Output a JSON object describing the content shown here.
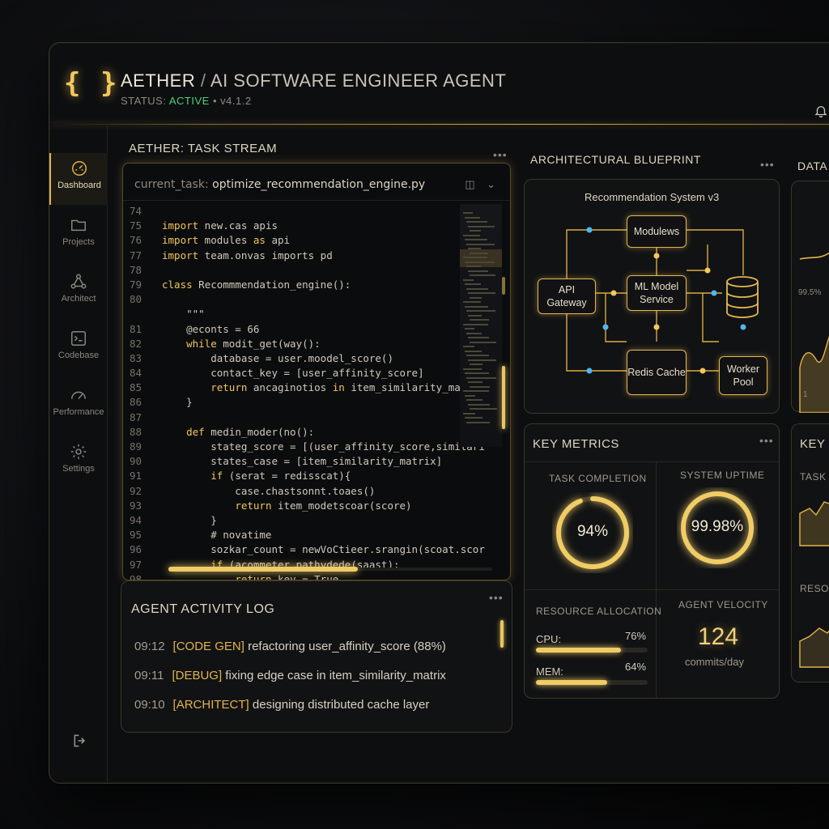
{
  "header": {
    "logo": "{ }",
    "app_name": "AETHER",
    "separator": "/",
    "subtitle": "AI SOFTWARE ENGINEER AGENT",
    "status_label": "STATUS:",
    "status_value": "ACTIVE",
    "version": "• v4.1.2"
  },
  "sidebar": {
    "items": [
      {
        "label": "Dashboard",
        "icon": "gauge-icon"
      },
      {
        "label": "Projects",
        "icon": "folder-icon"
      },
      {
        "label": "Architect",
        "icon": "nodes-icon"
      },
      {
        "label": "Codebase",
        "icon": "terminal-icon"
      },
      {
        "label": "Performance",
        "icon": "speedometer-icon"
      },
      {
        "label": "Settings",
        "icon": "gear-icon"
      }
    ]
  },
  "task_stream": {
    "title": "AETHER: TASK STREAM",
    "tab_prefix": "current_task:",
    "tab_file": "optimize_recommendation_engine.py",
    "lines": [
      {
        "n": "74",
        "code": ""
      },
      {
        "n": "75",
        "code": "import new.cas apis"
      },
      {
        "n": "76",
        "code": "import modules as api"
      },
      {
        "n": "77",
        "code": "import team.onvas imports pd"
      },
      {
        "n": "78",
        "code": ""
      },
      {
        "n": "79",
        "code": "class Recommmendation_engine():"
      },
      {
        "n": "80",
        "code": ""
      },
      {
        "n": "",
        "code": "    \"\"\""
      },
      {
        "n": "81",
        "code": "    @econts = 66"
      },
      {
        "n": "82",
        "code": "    while modit_get(way():"
      },
      {
        "n": "83",
        "code": "        database = user.moodel_score()"
      },
      {
        "n": "84",
        "code": "        contact_key = [user_affinity_score]"
      },
      {
        "n": "85",
        "code": "        return ancaginotios in item_similarity_matrix"
      },
      {
        "n": "86",
        "code": "    }"
      },
      {
        "n": "87",
        "code": ""
      },
      {
        "n": "88",
        "code": "    def medin_moder(no():"
      },
      {
        "n": "89",
        "code": "        stateg_score = [(user_affinity_score,similari"
      },
      {
        "n": "90",
        "code": "        states_case = [item_similarity_matrix]"
      },
      {
        "n": "91",
        "code": "        if (serat = redisscat){"
      },
      {
        "n": "92",
        "code": "            case.chastsonnt.toaes()"
      },
      {
        "n": "93",
        "code": "            return item_modetscoar(score)"
      },
      {
        "n": "94",
        "code": "        }"
      },
      {
        "n": "95",
        "code": "        # novatime"
      },
      {
        "n": "96",
        "code": "        sozkar_count = newVoCtieer.srangin(scoat.scor"
      },
      {
        "n": "97",
        "code": "        if (acommeter.pathvdede(saast):"
      },
      {
        "n": "98",
        "code": "            return key = True"
      }
    ]
  },
  "activity_log": {
    "title": "AGENT ACTIVITY LOG",
    "entries": [
      {
        "time": "09:12",
        "tag": "[CODE GEN]",
        "text": "refactoring user_affinity_score (88%)"
      },
      {
        "time": "09:11",
        "tag": "[DEBUG]",
        "text": "fixing edge case in item_similarity_matrix"
      },
      {
        "time": "09:10",
        "tag": "[ARCHITECT]",
        "text": "designing distributed cache layer"
      }
    ]
  },
  "blueprint": {
    "title": "ARCHITECTURAL BLUEPRINT",
    "caption": "Recommendation System v3",
    "nodes": {
      "modules": "Modulews",
      "api": "API Gateway",
      "ml": "ML Model Service",
      "redis": "Redis Cache",
      "worker": "Worker Pool",
      "db": "database-icon"
    }
  },
  "metrics": {
    "title": "KEY METRICS",
    "task_completion_label": "TASK COMPLETION",
    "task_completion_value": "94%",
    "task_completion_fraction": 0.94,
    "uptime_label": "SYSTEM UPTIME",
    "uptime_value": "99.98%",
    "uptime_fraction": 0.9998,
    "resource_label": "RESOURCE ALLOCATION",
    "cpu_label": "CPU:",
    "cpu_value": "76%",
    "cpu_fraction": 0.76,
    "mem_label": "MEM:",
    "mem_value": "64%",
    "mem_fraction": 0.64,
    "velocity_label": "AGENT VELOCITY",
    "velocity_value": "124",
    "velocity_unit": "commits/day"
  },
  "right_panels": {
    "data_title": "DATA V",
    "data_value": "99.5%",
    "data_tick": "1",
    "key_title": "KEY G",
    "task_label": "TASK C",
    "resource_label": "RESOU"
  },
  "colors": {
    "accent": "#e2b44c",
    "active": "#4fd07a",
    "background": "#0d0e10"
  }
}
